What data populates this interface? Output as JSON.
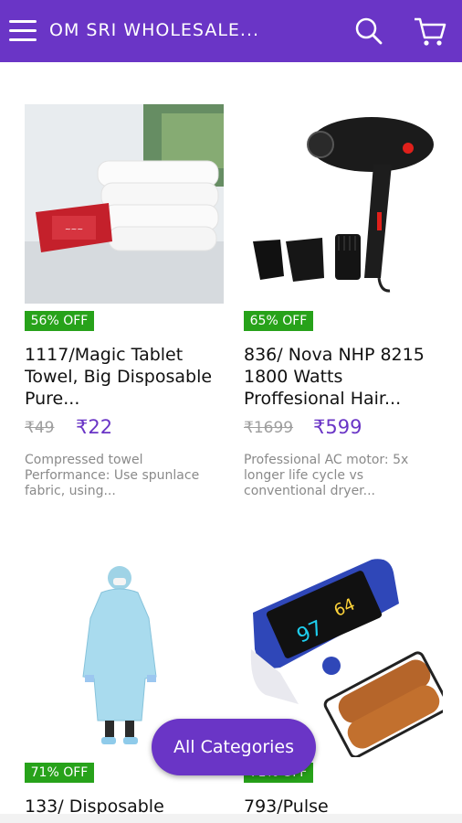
{
  "header": {
    "title": "OM SRI WHOLESALE...",
    "icons": {
      "menu": "menu-icon",
      "search": "search-icon",
      "cart": "cart-icon"
    },
    "bg_color": "#6a35c6"
  },
  "products": [
    {
      "name": "1117/Magic Tablet Towel, Big Disposable Pure...",
      "discount": "56% OFF",
      "mrp": "₹49",
      "price": "₹22",
      "description": "Compressed towel Performance: Use spunlace fabric, using..."
    },
    {
      "name": "836/ Nova NHP 8215 1800 Watts Proffesional Hair...",
      "discount": "65% OFF",
      "mrp": "₹1699",
      "price": "₹599",
      "description": "Professional AC motor: 5x longer life cycle vs conventional dryer..."
    },
    {
      "name": "133/ Disposable",
      "discount": "71% OFF"
    },
    {
      "name": "793/Pulse",
      "discount": "71% OFF"
    }
  ],
  "fab": {
    "label": "All Categories"
  },
  "colors": {
    "accent": "#6a35c6",
    "discount_badge": "#27a21a",
    "price": "#6a35c6"
  }
}
